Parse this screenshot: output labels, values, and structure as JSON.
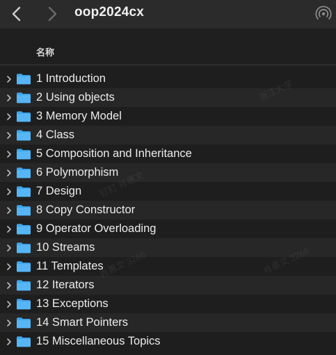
{
  "toolbar": {
    "title": "oop2024cx"
  },
  "header": {
    "name_column": "名称"
  },
  "items": [
    {
      "label": "1 Introduction"
    },
    {
      "label": "2 Using objects"
    },
    {
      "label": "3 Memory Model"
    },
    {
      "label": "4 Class"
    },
    {
      "label": "5 Composition and Inheritance"
    },
    {
      "label": "6 Polymorphism"
    },
    {
      "label": "7 Design"
    },
    {
      "label": "8 Copy Constructor"
    },
    {
      "label": "9 Operator Overloading"
    },
    {
      "label": "10 Streams"
    },
    {
      "label": "11 Templates"
    },
    {
      "label": "12 Iterators"
    },
    {
      "label": "13 Exceptions"
    },
    {
      "label": "14 Smart Pointers"
    },
    {
      "label": "15 Miscellaneous Topics"
    }
  ],
  "watermarks": [
    "浙江大学",
    "钉钉 肖惠文",
    "肖惠文 3266",
    "肖惠文 3266"
  ],
  "colors": {
    "folder": "#3ea6ef",
    "background": "#1e1e1e",
    "toolbar": "#2b2b2b"
  }
}
